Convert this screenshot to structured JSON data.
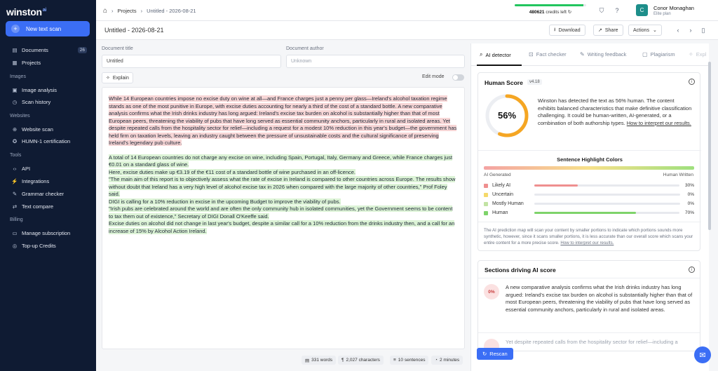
{
  "brand": {
    "name": "winston",
    "suffix": "ai"
  },
  "sidebar": {
    "new_scan": "New text scan",
    "items": [
      {
        "label": "Documents",
        "badge": "26"
      },
      {
        "label": "Projects"
      }
    ],
    "sections": [
      {
        "title": "Images",
        "items": [
          {
            "label": "Image analysis"
          },
          {
            "label": "Scan history"
          }
        ]
      },
      {
        "title": "Websites",
        "items": [
          {
            "label": "Website scan"
          },
          {
            "label": "HUMN-1 certification"
          }
        ]
      },
      {
        "title": "Tools",
        "items": [
          {
            "label": "API"
          },
          {
            "label": "Integrations"
          },
          {
            "label": "Grammar checker"
          },
          {
            "label": "Text compare"
          }
        ]
      },
      {
        "title": "Billing",
        "items": [
          {
            "label": "Manage subscription"
          },
          {
            "label": "Top-up Credits"
          }
        ]
      }
    ]
  },
  "topbar": {
    "breadcrumb": [
      "Projects",
      "Untitled - 2026-08-21"
    ],
    "credits": {
      "amount": "480621",
      "label": "credits left",
      "fraction": 0.96
    },
    "user": {
      "initial": "C",
      "name": "Conor Monaghan",
      "plan": "Elite plan"
    }
  },
  "docbar": {
    "title": "Untitled - 2026-08-21",
    "download": "Download",
    "share": "Share",
    "actions": "Actions"
  },
  "form": {
    "doc_title_label": "Document title",
    "doc_title_value": "Untitled",
    "doc_author_label": "Document author",
    "doc_author_placeholder": "Unknown",
    "explain": "Explain",
    "edit_mode": "Edit mode"
  },
  "editor": {
    "p1": "While 14 European countries impose no excise duty on wine at all—and France charges just a penny per glass—Ireland's alcohol taxation regime stands as one of the most punitive in Europe, with excise duties accounting for nearly a third of the cost of a standard bottle. A new comparative analysis confirms what the Irish drinks industry has long argued: Ireland's excise tax burden on alcohol is substantially higher than that of most European peers, threatening the viability of pubs that have long served as essential community anchors, particularly in rural and isolated areas. Yet despite repeated calls from the hospitality sector for relief—including a request for a modest 10% reduction in this year's budget—the government has held firm on taxation levels, leaving an industry caught between the pressure of unsustainable costs and the cultural significance of preserving Ireland's legendary pub culture.",
    "p2": [
      "A total of 14 European countries do not charge any excise on wine, including Spain, Portugal, Italy, Germany and Greece, while France charges just €0.01 on a standard glass of wine.",
      "Here, excise duties make up €3.19 of the €11 cost of a standard bottle of wine purchased in an off-licence.",
      "\"The main aim of this report is to objectively assess what the rate of excise in Ireland is compared to other countries across Europe. The results show without doubt that Ireland has a very high level of alcohol excise tax in 2026 when compared with the large majority of other countries,\" Prof Foley said.",
      "DIGI is calling for a 10% reduction in excise in the upcoming Budget to improve the viability of pubs.",
      "\"Irish pubs are celebrated around the world and are often the only community hub in isolated communities, yet the Government seems to be content to tax them out of existence,\" Secretary of DIGI Donall O'Keeffe said.",
      "Excise duties on alcohol did not change in last year's budget, despite a similar call for a 10% reduction from the drinks industry then, and a call for an increase of 15% by Alcohol Action Ireland."
    ]
  },
  "stats": {
    "words": "331 words",
    "characters": "2,027 characters",
    "sentences": "10 sentences",
    "time": "2 minutes"
  },
  "tabs": [
    "AI detector",
    "Fact checker",
    "Writing feedback",
    "Plagiarism",
    "Expl"
  ],
  "human_score": {
    "title": "Human Score",
    "version": "v4.18",
    "value": 56,
    "value_text": "56%",
    "summary": "Winston has detected the text as 56% human. The content exhibits balanced characteristics that make definitive classification challenging. It could be human-written, AI-generated, or a combination of both authorship types.",
    "summary_link": "How to interpret our results.",
    "highlight_title": "Sentence Highlight Colors",
    "ai_label": "AI Generated",
    "human_label": "Human Written",
    "legend": [
      {
        "name": "Likely AI",
        "value": 30,
        "text": "30%",
        "color": "#ef8f8f"
      },
      {
        "name": "Uncertain",
        "value": 0,
        "text": "0%",
        "color": "#f5d96b"
      },
      {
        "name": "Mostly Human",
        "value": 0,
        "text": "0%",
        "color": "#c2e3a3"
      },
      {
        "name": "Human",
        "value": 70,
        "text": "70%",
        "color": "#7ed36a"
      }
    ],
    "footer": "The AI prediction map will scan your content by smaller portions to indicate which portions sounds more synthetic, however, since it scans smaller portions, it is less accurate than our overall score which scans your entire content for a more precise score.",
    "footer_link": "How to interpret our results."
  },
  "sections": {
    "title": "Sections driving AI score",
    "items": [
      {
        "pct": "0%",
        "text": "A new comparative analysis confirms what the Irish drinks industry has long argued: Ireland's excise tax burden on alcohol is substantially higher than that of most European peers, threatening the viability of pubs that have long served as essential community anchors, particularly in rural and isolated areas."
      },
      {
        "pct": "",
        "text": "Yet despite repeated calls from the hospitality sector for relief—including a"
      }
    ]
  },
  "rescan": "Rescan",
  "colors": {
    "accent": "#3b6ef5",
    "sidebar": "#0f1b33",
    "gauge": "#f5a623"
  }
}
